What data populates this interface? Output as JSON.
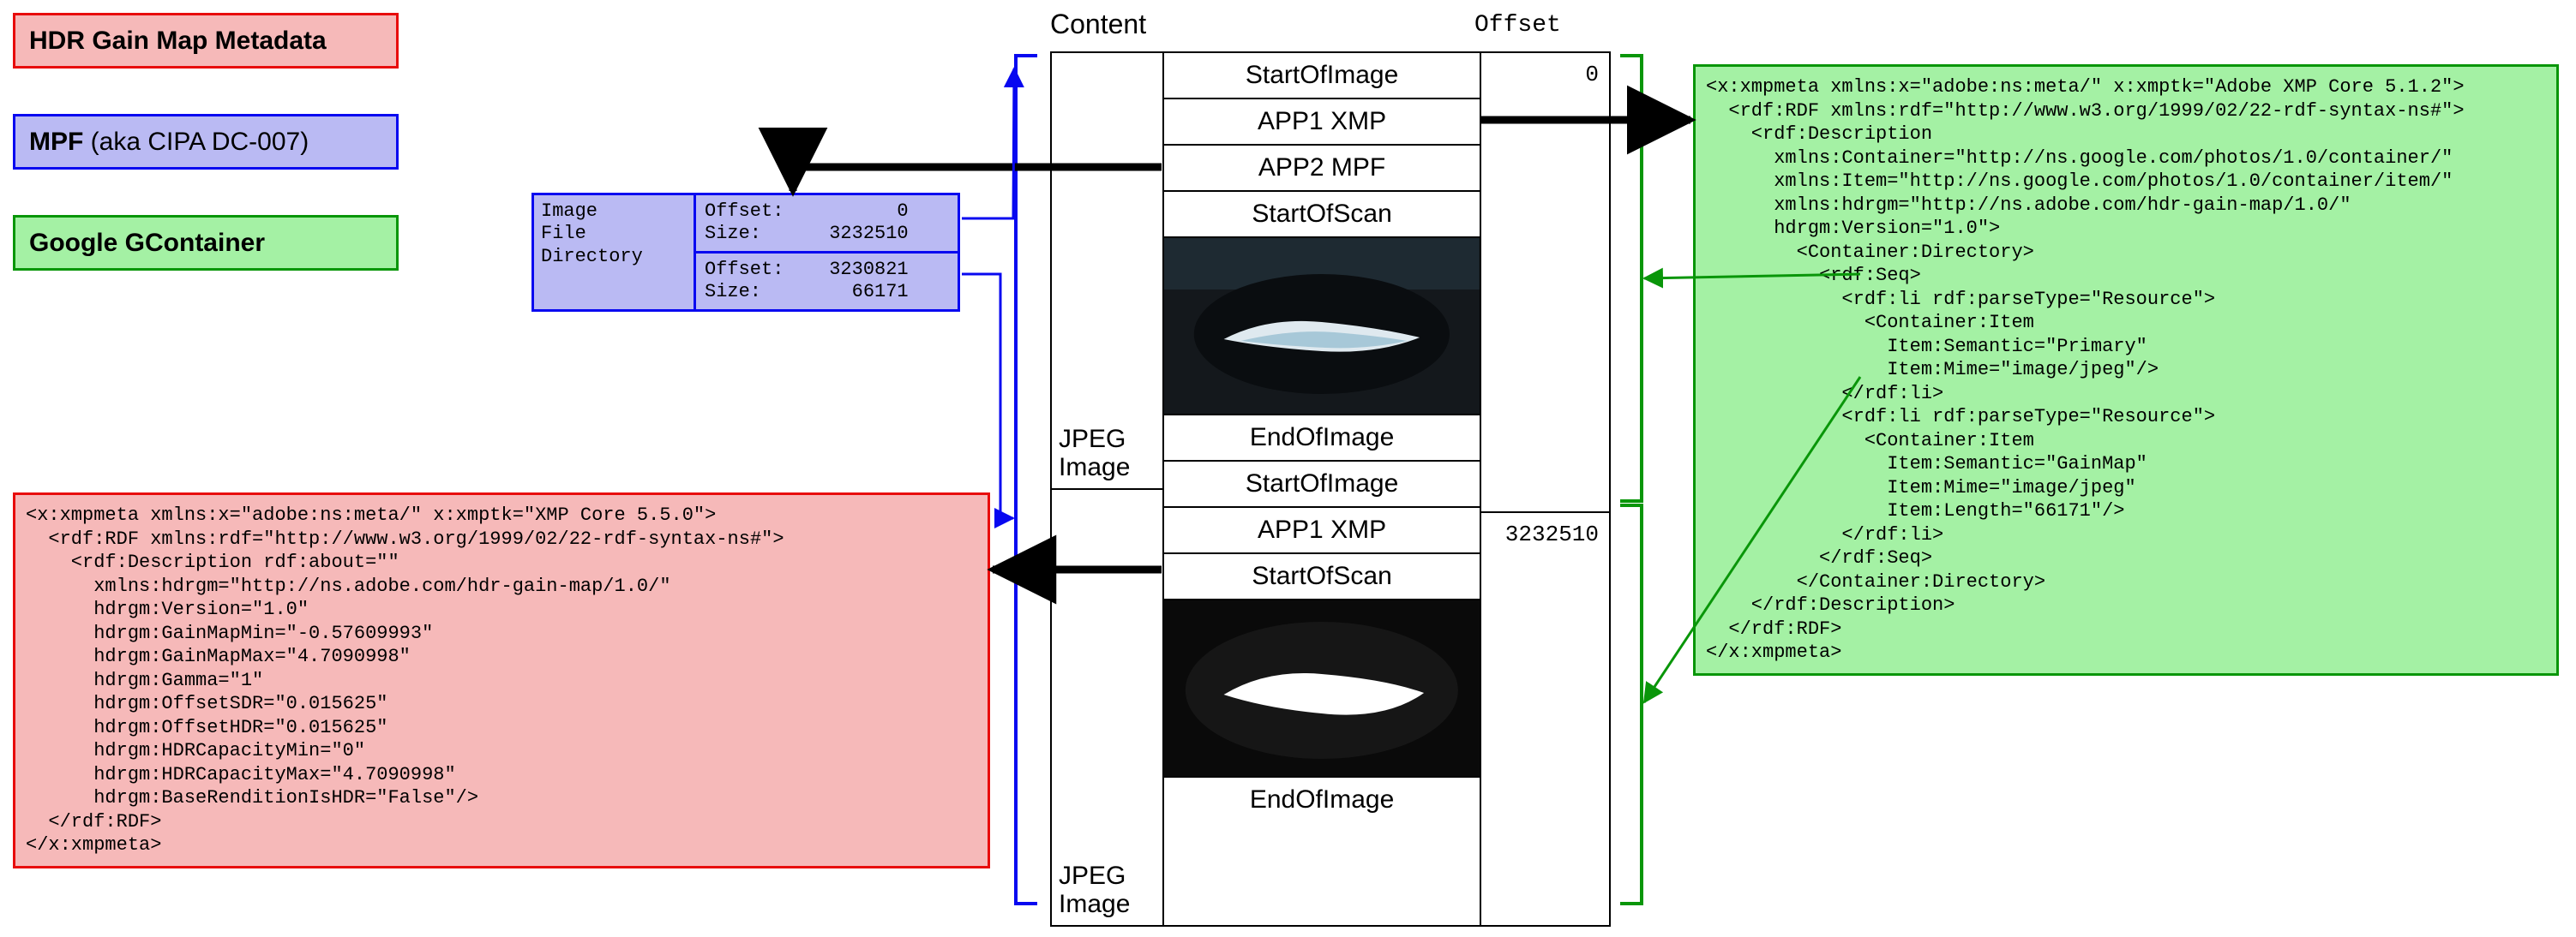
{
  "legend": {
    "hdr": "HDR Gain Map Metadata",
    "mpf_bold": "MPF",
    "mpf_rest": " (aka CIPA DC-007)",
    "gcon": "Google GContainer"
  },
  "headings": {
    "content": "Content",
    "offset": "Offset"
  },
  "mpf_table": {
    "left": "Image\nFile\nDirectory",
    "row0": "Offset:          0\nSize:      3232510",
    "row1": "Offset:    3230821\nSize:        66171"
  },
  "content_column": {
    "left_label": "JPEG\nImage",
    "top": {
      "rows": [
        "StartOfImage",
        "APP1 XMP",
        "APP2 MPF",
        "StartOfScan"
      ],
      "end": "EndOfImage",
      "offset": "0"
    },
    "bottom": {
      "rows": [
        "StartOfImage",
        "APP1 XMP",
        "StartOfScan"
      ],
      "end": "EndOfImage",
      "offset": "3232510"
    }
  },
  "hdr_xmp": "<x:xmpmeta xmlns:x=\"adobe:ns:meta/\" x:xmptk=\"XMP Core 5.5.0\">\n  <rdf:RDF xmlns:rdf=\"http://www.w3.org/1999/02/22-rdf-syntax-ns#\">\n    <rdf:Description rdf:about=\"\"\n      xmlns:hdrgm=\"http://ns.adobe.com/hdr-gain-map/1.0/\"\n      hdrgm:Version=\"1.0\"\n      hdrgm:GainMapMin=\"-0.57609993\"\n      hdrgm:GainMapMax=\"4.7090998\"\n      hdrgm:Gamma=\"1\"\n      hdrgm:OffsetSDR=\"0.015625\"\n      hdrgm:OffsetHDR=\"0.015625\"\n      hdrgm:HDRCapacityMin=\"0\"\n      hdrgm:HDRCapacityMax=\"4.7090998\"\n      hdrgm:BaseRenditionIsHDR=\"False\"/>\n  </rdf:RDF>\n</x:xmpmeta>",
  "gcon_xmp": "<x:xmpmeta xmlns:x=\"adobe:ns:meta/\" x:xmptk=\"Adobe XMP Core 5.1.2\">\n  <rdf:RDF xmlns:rdf=\"http://www.w3.org/1999/02/22-rdf-syntax-ns#\">\n    <rdf:Description\n      xmlns:Container=\"http://ns.google.com/photos/1.0/container/\"\n      xmlns:Item=\"http://ns.google.com/photos/1.0/container/item/\"\n      xmlns:hdrgm=\"http://ns.adobe.com/hdr-gain-map/1.0/\"\n      hdrgm:Version=\"1.0\">\n        <Container:Directory>\n          <rdf:Seq>\n            <rdf:li rdf:parseType=\"Resource\">\n              <Container:Item\n                Item:Semantic=\"Primary\"\n                Item:Mime=\"image/jpeg\"/>\n            </rdf:li>\n            <rdf:li rdf:parseType=\"Resource\">\n              <Container:Item\n                Item:Semantic=\"GainMap\"\n                Item:Mime=\"image/jpeg\"\n                Item:Length=\"66171\"/>\n            </rdf:li>\n          </rdf:Seq>\n        </Container:Directory>\n    </rdf:Description>\n  </rdf:RDF>\n</x:xmpmeta>"
}
